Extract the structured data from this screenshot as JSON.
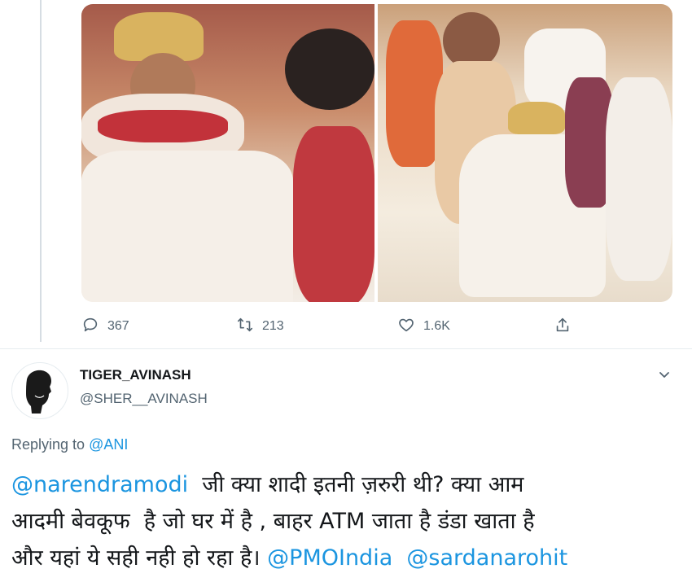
{
  "actions": {
    "reply_count": "367",
    "retweet_count": "213",
    "like_count": "1.6K"
  },
  "user": {
    "name": "TIGER_AVINASH",
    "handle": "@SHER__AVINASH"
  },
  "reply_context": {
    "prefix": "Replying to ",
    "mention": "@ANI"
  },
  "tweet": {
    "line1_mention": "@narendramodi",
    "line1_text": "  जी क्या शादी इतनी ज़रुरी थी? क्या आम",
    "line2_text": "आदमी बेवकूफ  है जो घर में है , बाहर ATM जाता है डंडा खाता है",
    "line3_text": "और यहां ये सही नही हो रहा है। ",
    "line3_mention1": "@PMOIndia",
    "line3_mention2": "@sardanarohit"
  },
  "colors": {
    "accent": "#1b95e0",
    "secondary_text": "#536471",
    "divider": "#e6ecf0"
  },
  "icons": [
    "reply-icon",
    "retweet-icon",
    "like-icon",
    "share-icon",
    "chevron-down-icon"
  ]
}
